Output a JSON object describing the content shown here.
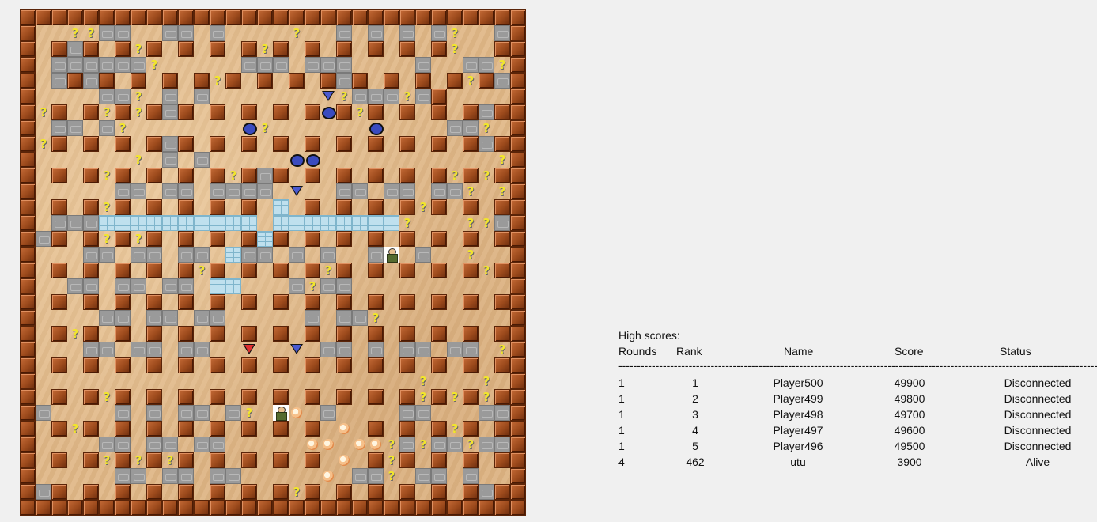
{
  "board": {
    "size": 32,
    "rows": [
      "WWWWWWWWWWWWWWWWWWWWWWWWWWWWWWWW",
      "W..QQSS..SS.S....Q..S.S.S.SQ..SQSSW",
      "W.WSW.WQW.W.W.WQW.W.W.W.W.WQ..WSW",
      "W.SSSSSSQ.....SSS.SSS....S..SSQSW",
      "W.SWSW.W.W.WQW.W.W.WSW.W.W.WQWSW",
      "W....SSQ.S.S.......TQSSSQSW",
      "WQW.WQWQWSW.W.W.W.WOWQW.W.W.WSW",
      "W.SS.SQ.......OQ......O....SSQ.W",
      "WQW.W.W.WSW.W.W.W.W.W.W.W.W.WSWW",
      "W......Q.S.S.....OO...........QSW",
      "W.W.WQW.W.W.WQWSW.W.W.W.W.WQWQW",
      "W.....SS.SS.SSSS.T..SS.SS.SSQ.Q.W",
      "W.W.WQW.W.W.W.W.B.W.W.W.WQW.W.WSW",
      "W.SSSBBBBBBBBBB.BBBBBBBBQ...QQSS.W",
      "WSW.WQWQW.W.W.WBW.W.W.W.W.W.W.W.W",
      "W...SS.SS.SS.BSS.S.S..SP.S..Q..SQW",
      "W.W.W.W.W.WQW.W.W.WQW.W.W.W.WQWW",
      "W..SS.SS.SS.BB...SQSS..........W",
      "W.W.W.W.W.W.W.W.W.W.W.W.W.W.W.W.W",
      "W....SS.SS.SS.....S.SSQ........W",
      "W.WQW.W.W.W.W.W.W.W.W.W.W.W.W.W.W",
      "W...SS.SS.SS.....T.SS.S.SS.SS.QSW",
      "W.W.W.W.W.W.W.W.W.W.W.W.W.W.W.WQW",
      "W........................Q...Q.W",
      "W.W.WQW.W.W.W.W.W.W.W.W.WQWQWQW.W",
      "WS....S.S.SS.SQ.PE.S....SS...SSW",
      "W.WQW.W.W.W.W.W.W.W.E.W.W.WQW.W.W",
      "W....SS.SS.SS.....EE.EEQSQSSQSSW",
      "W.W.WQWQWQW.W.W.W.W.E.WQW.W.W.W.W",
      "W.....SS.SS.SS.....E.SSQ.SS.S..W",
      "WSW.W.W.W.W.W.W.WQW.W.W.W.W.WSW.W",
      "WWWWWWWWWWWWWWWWWWWWWWWWWWWWWWWW"
    ]
  },
  "high_scores": {
    "title": "High scores:",
    "headers": {
      "rounds": "Rounds",
      "rank": "Rank",
      "name": "Name",
      "score": "Score",
      "status": "Status"
    },
    "separator": "------------------------------------------------------------------------------------------------------------------------------------------------------------------------",
    "rows": [
      {
        "rounds": "1",
        "rank": "1",
        "name": "Player500",
        "score": "49900",
        "status": "Disconnected"
      },
      {
        "rounds": "1",
        "rank": "2",
        "name": "Player499",
        "score": "49800",
        "status": "Disconnected"
      },
      {
        "rounds": "1",
        "rank": "3",
        "name": "Player498",
        "score": "49700",
        "status": "Disconnected"
      },
      {
        "rounds": "1",
        "rank": "4",
        "name": "Player497",
        "score": "49600",
        "status": "Disconnected"
      },
      {
        "rounds": "1",
        "rank": "5",
        "name": "Player496",
        "score": "49500",
        "status": "Disconnected"
      },
      {
        "rounds": "4",
        "rank": "462",
        "name": "utu",
        "score": "3900",
        "status": "Alive"
      }
    ]
  }
}
